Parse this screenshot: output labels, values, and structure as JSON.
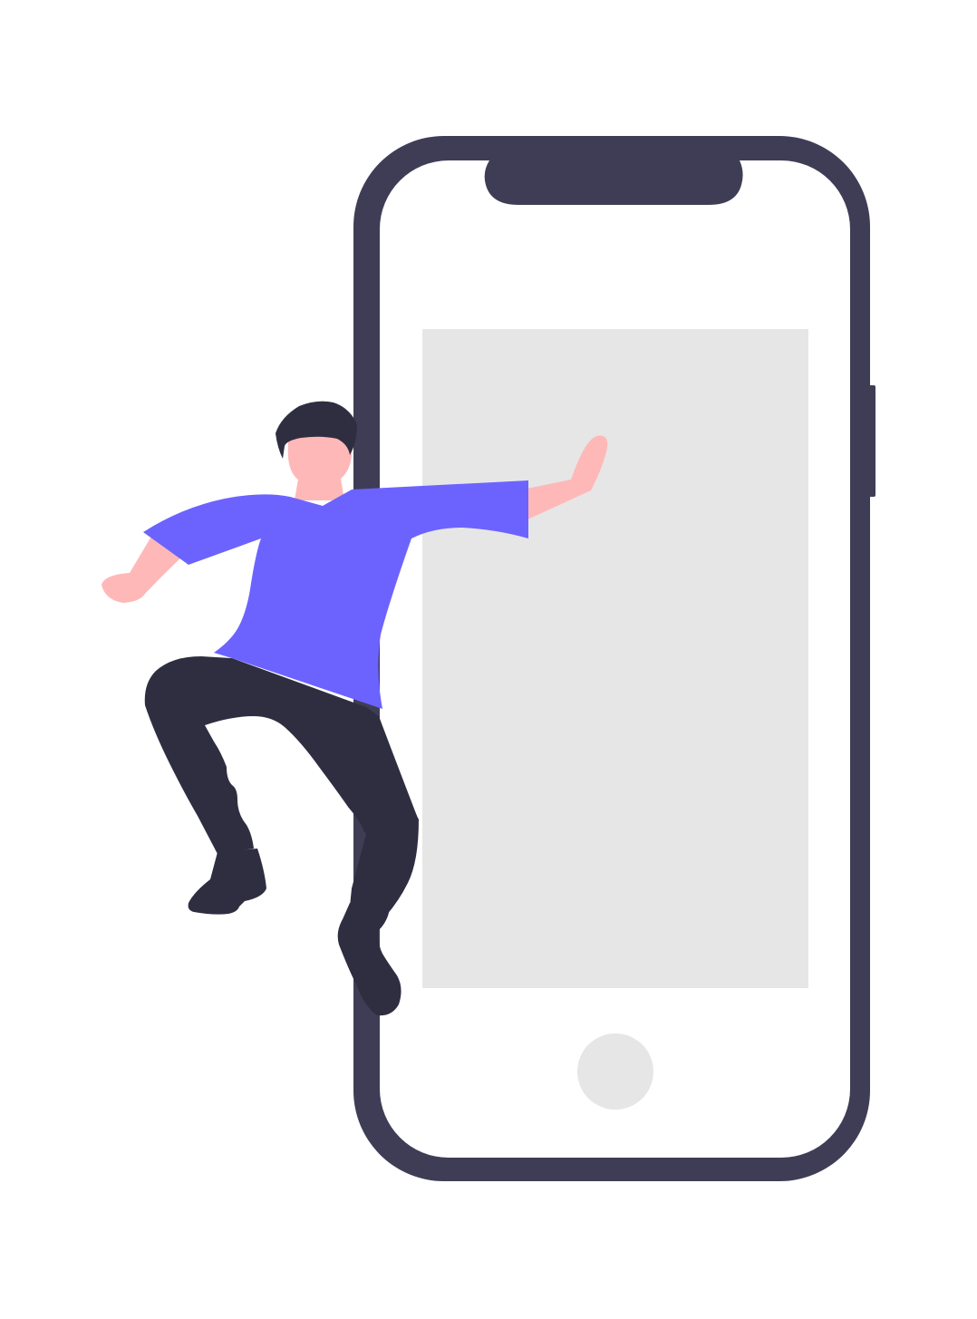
{
  "illustration": {
    "colors": {
      "background": "#ffffff",
      "phone_frame": "#3f3d56",
      "phone_screen": "#ffffff",
      "screen_content": "#e6e6e6",
      "home_button": "#e6e6e6",
      "shirt": "#6c63ff",
      "skin": "#ffb8b8",
      "hair": "#2f2e41",
      "pants": "#2f2e41",
      "shoes": "#2f2e41"
    },
    "icons": {
      "phone": "smartphone-icon",
      "person": "person-figure-icon"
    }
  }
}
